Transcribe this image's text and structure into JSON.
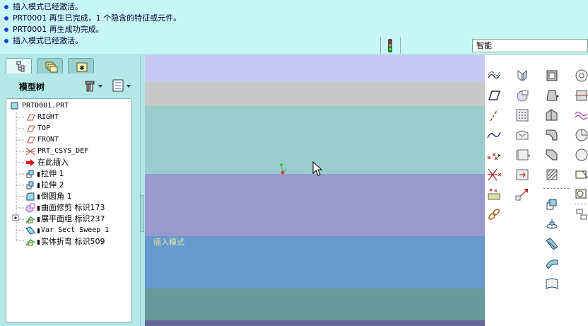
{
  "messages": [
    "插入模式已经激活。",
    "PRT0001 再生已完成，1 个隐含的特征或元件。",
    "PRT0001 再生成功完成。",
    "插入模式已经激活。"
  ],
  "filter": {
    "selected": "智能"
  },
  "model_tree": {
    "title": "模型树",
    "items": [
      {
        "label": "PRT0001.PRT",
        "icon": "part-icon"
      },
      {
        "label": "RIGHT",
        "icon": "datum-plane-icon"
      },
      {
        "label": "TOP",
        "icon": "datum-plane-icon"
      },
      {
        "label": "FRONT",
        "icon": "datum-plane-icon"
      },
      {
        "label": "PRT_CSYS_DEF",
        "icon": "csys-icon"
      },
      {
        "label": "在此插入",
        "icon": "insert-here-arrow-icon"
      },
      {
        "label": "拉伸 1",
        "icon": "extrude-icon"
      },
      {
        "label": "拉伸 2",
        "icon": "extrude-icon"
      },
      {
        "label": "倒圆角 1",
        "icon": "round-icon"
      },
      {
        "label": "曲面修剪 标识173",
        "icon": "surface-trim-icon"
      },
      {
        "label": "展平面组 标识237",
        "icon": "flatten-quilt-icon"
      },
      {
        "label": "Var Sect Sweep 1",
        "icon": "var-sweep-icon"
      },
      {
        "label": "实体折弯 标识509",
        "icon": "solid-bend-icon"
      }
    ]
  },
  "graphics": {
    "overlay_text": "插入模式",
    "bands": [
      "#c8c8f5",
      "#c8c8c8",
      "#99cccc",
      "#9999cc",
      "#6699cc",
      "#669999",
      "#666699"
    ]
  }
}
